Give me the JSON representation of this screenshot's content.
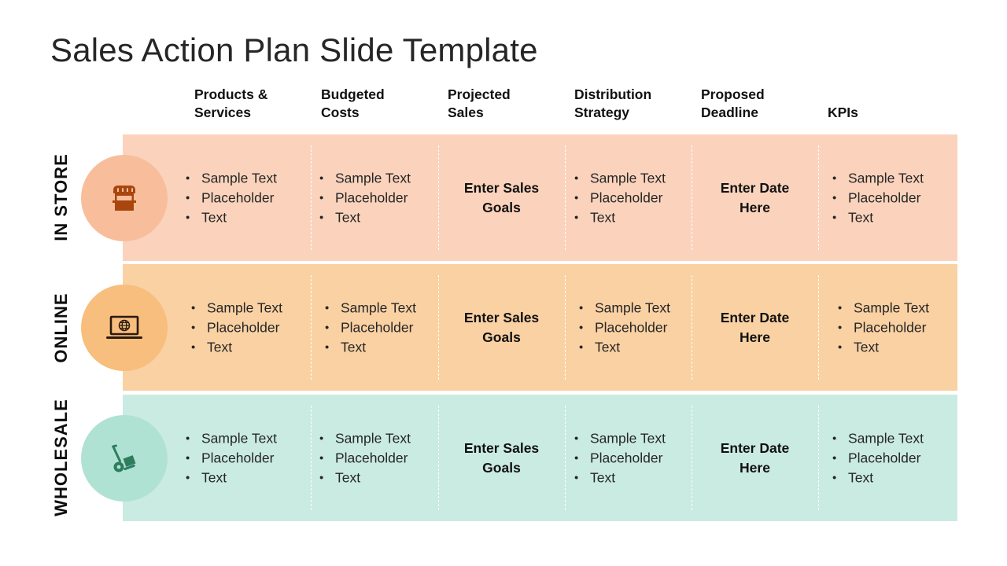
{
  "slide": {
    "title": "Sales Action Plan Slide Template"
  },
  "columns": [
    {
      "label": "Products &\nServices"
    },
    {
      "label": "Budgeted\nCosts"
    },
    {
      "label": "Projected\nSales"
    },
    {
      "label": "Distribution\nStrategy"
    },
    {
      "label": "Proposed\nDeadline"
    },
    {
      "label": "KPIs"
    }
  ],
  "rows": [
    {
      "label": "IN STORE",
      "icon": "store-icon",
      "band_color": "#FBD3BC",
      "circle_color": "#F8BE9C",
      "icon_color": "#A8460E",
      "products": [
        "Sample Text",
        "Placeholder",
        "Text"
      ],
      "costs": [
        "Sample Text",
        "Placeholder",
        "Text"
      ],
      "sales": "Enter Sales\nGoals",
      "distribution": [
        "Sample Text",
        "Placeholder",
        "Text"
      ],
      "deadline": "Enter Date\nHere",
      "kpis": [
        "Sample Text",
        "Placeholder",
        "Text"
      ]
    },
    {
      "label": "ONLINE",
      "icon": "laptop-globe-icon",
      "band_color": "#FAD1A3",
      "circle_color": "#F7BE7D",
      "icon_color": "#2A1A10",
      "products": [
        "Sample Text",
        "Placeholder",
        "Text"
      ],
      "costs": [
        "Sample Text",
        "Placeholder",
        "Text"
      ],
      "sales": "Enter Sales\nGoals",
      "distribution": [
        "Sample Text",
        "Placeholder",
        "Text"
      ],
      "deadline": "Enter Date\nHere",
      "kpis": [
        "Sample Text",
        "Placeholder",
        "Text"
      ]
    },
    {
      "label": "WHOLESALE",
      "icon": "hand-truck-icon",
      "band_color": "#CAEBE2",
      "circle_color": "#B0E2D4",
      "icon_color": "#2E7D5F",
      "products": [
        "Sample Text",
        "Placeholder",
        "Text"
      ],
      "costs": [
        "Sample Text",
        "Placeholder",
        "Text"
      ],
      "sales": "Enter Sales\nGoals",
      "distribution": [
        "Sample Text",
        "Placeholder",
        "Text"
      ],
      "deadline": "Enter Date\nHere",
      "kpis": [
        "Sample Text",
        "Placeholder",
        "Text"
      ]
    }
  ]
}
